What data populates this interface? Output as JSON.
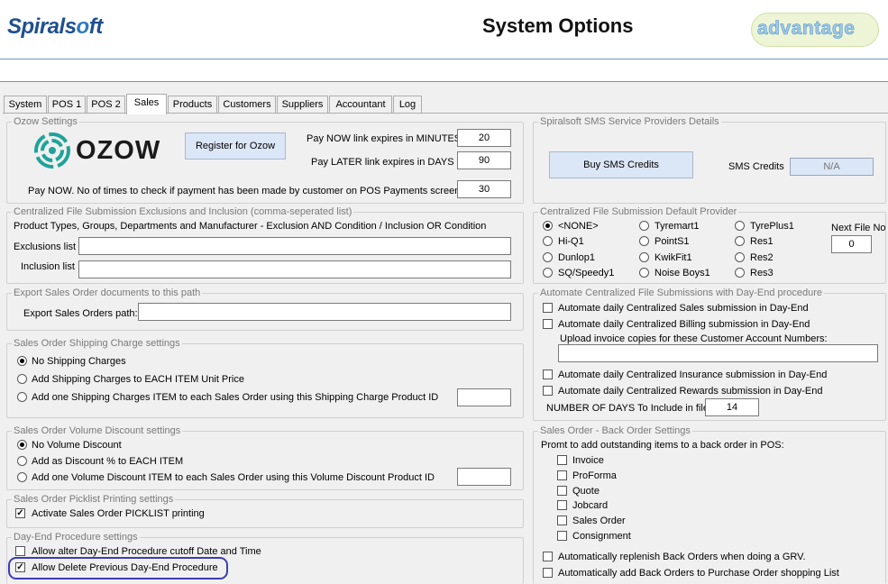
{
  "header": {
    "logo_a": "Spirals",
    "logo_o": "o",
    "logo_b": "ft",
    "title": "System Options",
    "brand": "advantage"
  },
  "tabs": [
    "System",
    "POS 1",
    "POS 2",
    "Sales",
    "Products",
    "Customers",
    "Suppliers",
    "Accountant",
    "Log"
  ],
  "ozow": {
    "group": "Ozow Settings",
    "logo_text": "OZOW",
    "register": "Register for Ozow",
    "now_label": "Pay NOW link expires in MINUTES",
    "now_value": "20",
    "later_label": "Pay LATER link expires in DAYS",
    "later_value": "90",
    "checks_label": "Pay NOW. No of times to check if payment has been made by customer on POS Payments screen",
    "checks_value": "30"
  },
  "cfse": {
    "group": "Centralized File Submission Exclusions and Inclusion (comma-seperated list)",
    "desc": "Product Types, Groups, Departments and Manufacturer - Exclusion AND Condition / Inclusion OR Condition",
    "excl": "Exclusions list",
    "incl": "Inclusion list",
    "excl_value": "",
    "incl_value": ""
  },
  "export": {
    "group": "Export Sales Order documents to this path",
    "label": "Export Sales Orders path:",
    "value": ""
  },
  "shipping": {
    "group": "Sales Order Shipping Charge settings",
    "opt1": "No Shipping Charges",
    "opt2": "Add Shipping Charges to EACH ITEM Unit Price",
    "opt3": "Add one Shipping Charges ITEM to each Sales Order using this Shipping Charge Product ID",
    "value": ""
  },
  "volume": {
    "group": "Sales Order Volume Discount settings",
    "opt1": "No Volume Discount",
    "opt2": "Add as Discount % to EACH ITEM",
    "opt3": "Add one Volume Discount ITEM to each Sales Order using this Volume Discount Product ID",
    "value": ""
  },
  "picklist": {
    "group": "Sales Order Picklist Printing settings",
    "label": "Activate Sales Order PICKLIST printing"
  },
  "dayend": {
    "group": "Day-End Procedure settings",
    "opt1": "Allow alter Day-End Procedure cutoff Date and Time",
    "opt2": "Allow Delete Previous Day-End Procedure"
  },
  "sms": {
    "group": "Spiralsoft SMS Service Providers Details",
    "buy": "Buy SMS Credits",
    "credits_label": "SMS Credits",
    "credits_value": "N/A"
  },
  "provider": {
    "group": "Centralized File Submission Default Provider",
    "col1": [
      "<NONE>",
      "Hi-Q1",
      "Dunlop1",
      "SQ/Speedy1"
    ],
    "col2": [
      "Tyremart1",
      "PointS1",
      "KwikFit1",
      "Noise Boys1"
    ],
    "col3": [
      "TyrePlus1",
      "Res1",
      "Res2",
      "Res3"
    ],
    "next_label": "Next File No",
    "next_value": "0"
  },
  "automate": {
    "group": "Automate Centralized File Submissions with Day-End procedure",
    "sales": "Automate daily Centralized Sales submission in Day-End",
    "billing": "Automate daily Centralized Billing submission in Day-End",
    "upload": "Upload invoice copies for these Customer Account Numbers:",
    "upload_value": "",
    "insurance": "Automate daily Centralized Insurance submission in Day-End",
    "rewards": "Automate daily Centralized Rewards submission in Day-End",
    "days_label": "NUMBER OF DAYS To Include in file",
    "days_value": "14"
  },
  "backorder": {
    "group": "Sales Order - Back Order Settings",
    "prompt": "Promt to add outstanding items to a back order in POS:",
    "items": [
      "Invoice",
      "ProForma",
      "Quote",
      "Jobcard",
      "Sales Order",
      "Consignment"
    ],
    "replenish": "Automatically replenish Back Orders when doing a GRV.",
    "add": "Automatically add Back Orders to Purchase Order shopping List"
  },
  "colors": {
    "highlight": "#3d3db8",
    "button": "#dbe6f6",
    "logo": "#1f4f8f"
  }
}
